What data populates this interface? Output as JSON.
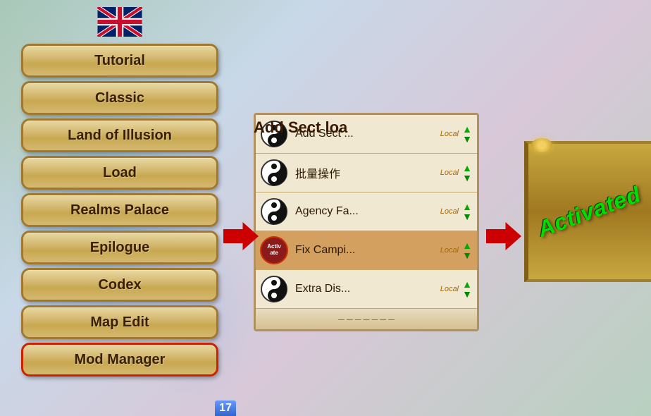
{
  "background": {
    "color": "#b8d4c8"
  },
  "left_menu": {
    "flag": "UK",
    "buttons": [
      {
        "id": "tutorial",
        "label": "Tutorial",
        "active": false
      },
      {
        "id": "classic",
        "label": "Classic",
        "active": false
      },
      {
        "id": "land-of-illusion",
        "label": "Land of Illusion",
        "active": false
      },
      {
        "id": "load",
        "label": "Load",
        "active": false
      },
      {
        "id": "realms-palace",
        "label": "Realms Palace",
        "active": false
      },
      {
        "id": "epilogue",
        "label": "Epilogue",
        "active": false
      },
      {
        "id": "codex",
        "label": "Codex",
        "active": false
      },
      {
        "id": "map-edit",
        "label": "Map Edit",
        "active": false
      },
      {
        "id": "mod-manager",
        "label": "Mod Manager",
        "active": true
      }
    ]
  },
  "mod_list": {
    "title": "Add Sect loa",
    "items": [
      {
        "id": "add-sect",
        "name": "Add Sect ...",
        "tag": "Local",
        "icon": "yin-yang",
        "highlighted": false
      },
      {
        "id": "batch-ops",
        "name": "批量操作",
        "tag": "Local",
        "icon": "yin-yang",
        "highlighted": false
      },
      {
        "id": "agency-fa",
        "name": "Agency Fa...",
        "tag": "Local",
        "icon": "yin-yang",
        "highlighted": false
      },
      {
        "id": "fix-campi",
        "name": "Fix Campi...",
        "tag": "Local",
        "icon": "activate",
        "highlighted": true
      },
      {
        "id": "extra-dis",
        "name": "Extra Dis...",
        "tag": "Local",
        "icon": "yin-yang",
        "highlighted": false
      }
    ]
  },
  "arrows": {
    "left_arrow_label": "→",
    "right_arrow_label": "→"
  },
  "right_panel": {
    "status": "Activated"
  },
  "badge": {
    "value": "17"
  }
}
